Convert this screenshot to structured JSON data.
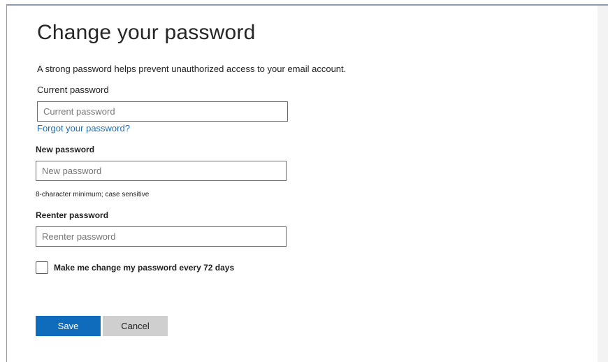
{
  "page": {
    "title": "Change your password",
    "description": "A strong password helps prevent unauthorized access to your email account."
  },
  "current_password": {
    "label": "Current password",
    "placeholder": "Current password",
    "value": ""
  },
  "forgot_link": "Forgot your password?",
  "new_password": {
    "label": "New password",
    "placeholder": "New password",
    "value": "",
    "hint": "8-character minimum; case sensitive"
  },
  "reenter_password": {
    "label": "Reenter password",
    "placeholder": "Reenter password",
    "value": ""
  },
  "expire_option": {
    "label": "Make me change my password every 72 days",
    "checked": false
  },
  "actions": {
    "save_label": "Save",
    "cancel_label": "Cancel"
  },
  "colors": {
    "primary": "#0f6cbd",
    "link": "#1f6fb5",
    "secondary_button": "#cfcfcf"
  }
}
